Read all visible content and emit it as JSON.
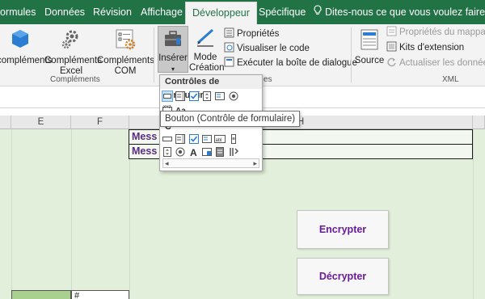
{
  "tabs": [
    {
      "label": "ormules",
      "active": false
    },
    {
      "label": "Données",
      "active": false
    },
    {
      "label": "Révision",
      "active": false
    },
    {
      "label": "Affichage",
      "active": false
    },
    {
      "label": "Développeur",
      "active": true
    },
    {
      "label": "Spécifique",
      "active": false
    }
  ],
  "tell_me": "Dites-nous ce que vous voulez faire",
  "ribbon": {
    "complements_label": "compléments",
    "complements_excel_line1": "Compléments",
    "complements_excel_line2": "Excel",
    "complements_com_line1": "Compléments",
    "complements_com_line2": "COM",
    "group_complements": "Compléments",
    "inserer": "Insérer",
    "mode_creation_line1": "Mode",
    "mode_creation_line2": "Création",
    "proprietes": "Propriétés",
    "visualiser_code": "Visualiser le code",
    "executer_boite": "Exécuter la boîte de dialogue",
    "group_controles_suffix": "es",
    "source": "Source",
    "proprietes_mappage": "Propriétés du mappage",
    "kits_extension": "Kits d'extension",
    "actualiser_donnees": "Actualiser les données",
    "group_xml": "XML"
  },
  "columns": [
    "E",
    "F",
    "H"
  ],
  "cells": {
    "msg1": "Mess",
    "msg2": "Mess",
    "b_partial": "#"
  },
  "buttons": {
    "encrypter": "Encrypter",
    "decrypter": "Décrypter"
  },
  "dropdown": {
    "header": "Contrôles de formulaire",
    "activex_partial": "C",
    "scroll_left": "◂",
    "scroll_right": "▸"
  },
  "tooltip": "Bouton (Contrôle de formulaire)",
  "colors": {
    "excel_green": "#217346",
    "sheet_bg": "#e2efda",
    "button_text": "#6a1b9a",
    "message_text": "#5a2d82"
  }
}
